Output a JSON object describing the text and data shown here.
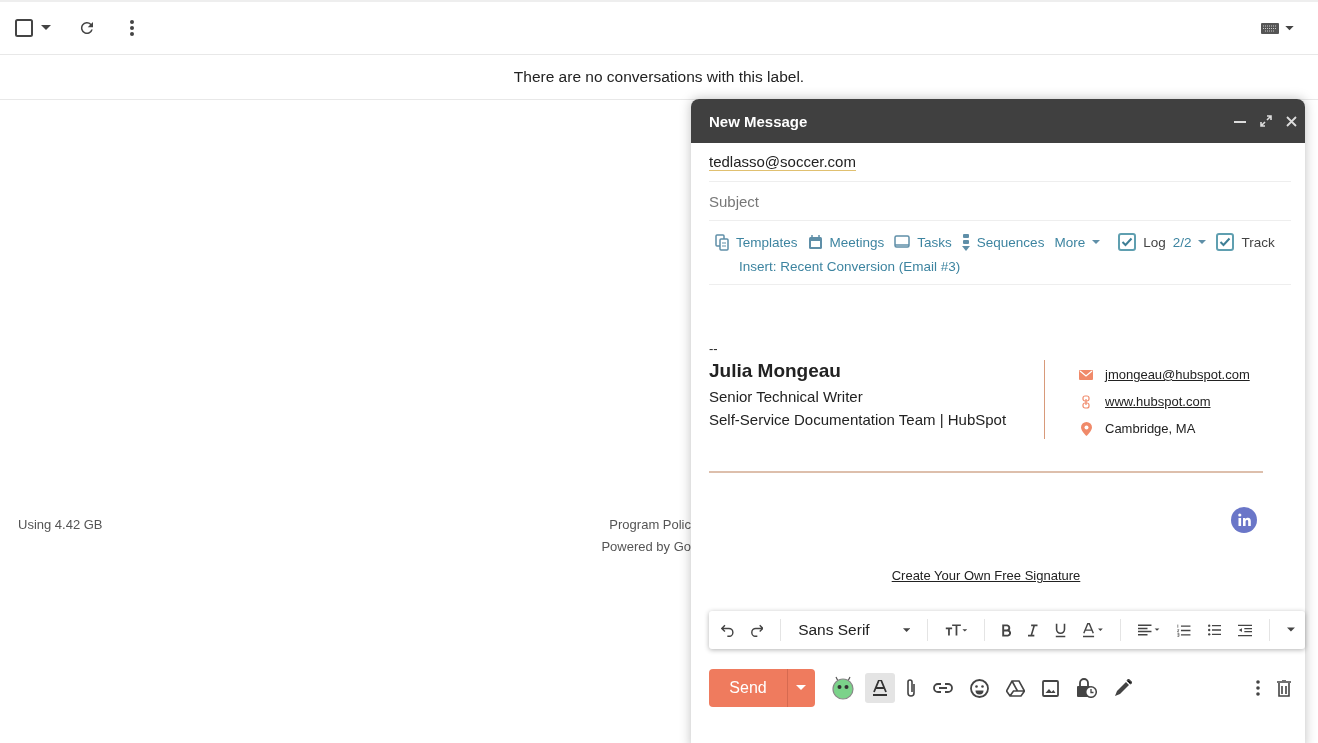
{
  "toolbar": {
    "select_all": {
      "checked": false
    }
  },
  "empty_message": "There are no conversations with this label.",
  "footer": {
    "storage": "Using 4.42 GB",
    "links": [
      "Program Polic",
      "Powered by Go"
    ]
  },
  "compose": {
    "title": "New Message",
    "to": "tedlasso@soccer.com",
    "subject": {
      "placeholder": "Subject"
    },
    "tools": [
      {
        "kind": "templates",
        "label": "Templates"
      },
      {
        "kind": "meetings",
        "label": "Meetings"
      },
      {
        "kind": "tasks",
        "label": "Tasks"
      },
      {
        "kind": "sequences",
        "label": "Sequences"
      }
    ],
    "more": "More",
    "log": {
      "checked": true,
      "label": "Log",
      "count": "2/2"
    },
    "track": {
      "checked": true,
      "label": "Track"
    },
    "insert": "Insert: Recent Conversion (Email #3)",
    "signature": {
      "dash": "--",
      "name": "Julia Mongeau",
      "job_title": "Senior Technical Writer",
      "team": "Self-Service Documentation Team | HubSpot",
      "contacts": [
        {
          "kind": "email",
          "text": "jmongeau@hubspot.com"
        },
        {
          "kind": "website",
          "text": "www.hubspot.com"
        },
        {
          "kind": "location",
          "text": "Cambridge, MA"
        }
      ],
      "cta": "Create Your Own Free Signature"
    },
    "font": "Sans Serif",
    "send": "Send"
  }
}
